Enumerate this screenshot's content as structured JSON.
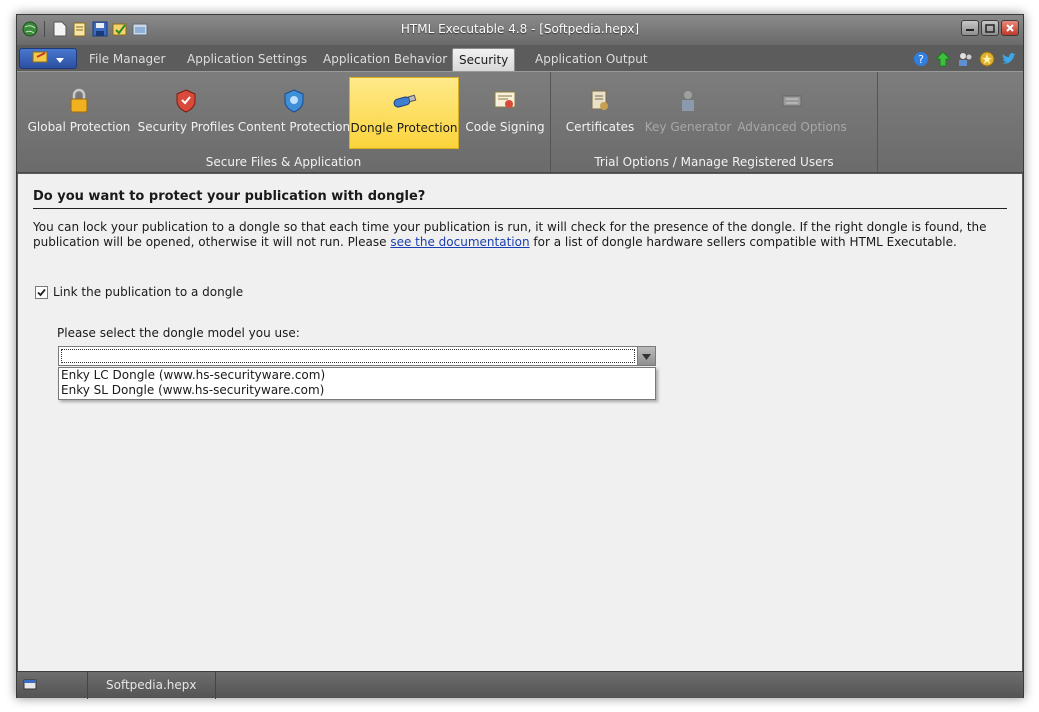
{
  "window": {
    "title": "HTML Executable 4.8 - [Softpedia.hepx]"
  },
  "quick_access": {
    "icons": [
      "app-globe-icon",
      "new-file-icon",
      "open-file-icon",
      "save-icon",
      "build-icon",
      "preview-icon"
    ]
  },
  "tabs": [
    {
      "label": "File Manager",
      "active": false
    },
    {
      "label": "Application Settings",
      "active": false
    },
    {
      "label": "Application Behavior",
      "active": false
    },
    {
      "label": "Security",
      "active": true
    },
    {
      "label": "Application Output",
      "active": false
    }
  ],
  "right_icons": [
    "help-icon",
    "update-arrow-icon",
    "users-icon",
    "award-icon",
    "twitter-icon"
  ],
  "ribbon": {
    "groups": [
      {
        "label": "Secure Files & Application",
        "buttons": [
          {
            "label": "Global Protection",
            "icon": "lock-icon",
            "state": "normal"
          },
          {
            "label": "Security Profiles",
            "icon": "shield-icon",
            "state": "normal"
          },
          {
            "label": "Content Protection",
            "icon": "content-shield-icon",
            "state": "normal"
          },
          {
            "label": "Dongle Protection",
            "icon": "dongle-icon",
            "state": "selected"
          },
          {
            "label": "Code Signing",
            "icon": "certificate-icon",
            "state": "normal"
          }
        ]
      },
      {
        "label": "Trial Options / Manage Registered Users",
        "buttons": [
          {
            "label": "Certificates",
            "icon": "certificates-icon",
            "state": "normal"
          },
          {
            "label": "Key Generator",
            "icon": "key-generator-icon",
            "state": "disabled"
          },
          {
            "label": "Advanced Options",
            "icon": "advanced-options-icon",
            "state": "disabled"
          }
        ]
      }
    ]
  },
  "content": {
    "heading": "Do you want to protect your publication with dongle?",
    "description_before_link": "You can lock your publication to a dongle so that each time your publication is run, it will check for the presence of the dongle. If the right dongle is found, the publication will be opened, otherwise it will not run. Please ",
    "link_text": "see the documentation",
    "description_after_link": " for a list of dongle hardware sellers compatible with HTML Executable.",
    "checkbox_label": "Link the publication to a dongle",
    "checkbox_checked": true,
    "select_label": "Please select the dongle model you use:",
    "select_value": "",
    "options": [
      "Enky LC Dongle (www.hs-securityware.com)",
      "Enky SL Dongle (www.hs-securityware.com)"
    ]
  },
  "status": {
    "filename": "Softpedia.hepx"
  },
  "colors": {
    "selected_button": "#fbd43c",
    "app_menu": "#2b4fa0",
    "link": "#1a3fb0",
    "ribbon_bg": "#737373"
  }
}
